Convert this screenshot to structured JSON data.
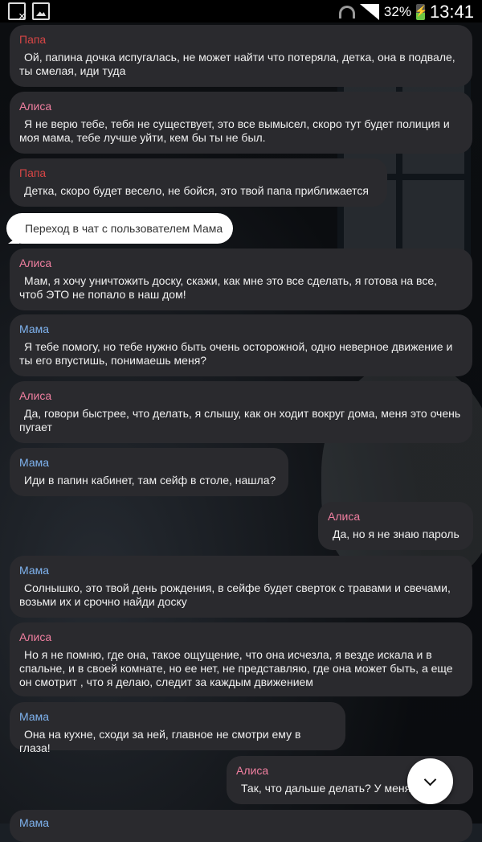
{
  "status": {
    "battery": "32%",
    "time": "13:41"
  },
  "messages": [
    {
      "sender": "Папа",
      "text": "Ой, папина дочка испугалась, не может найти что потеряла, детка, она в подвале, ты смелая, иди туда"
    },
    {
      "sender": "Алиса",
      "text": "Я не верю тебе, тебя не существует, это все вымысел, скоро тут будет полиция и моя мама, тебе лучше уйти, кем бы ты не был."
    },
    {
      "sender": "Папа",
      "text": "Детка, скоро будет весело, не бойся, это твой папа приближается"
    },
    {
      "system": "Переход в чат с пользователем Мама"
    },
    {
      "sender": "Алиса",
      "text": "Мам, я хочу уничтожить доску, скажи, как мне это все сделать, я готова на все, чтоб ЭТО не попало в наш дом!"
    },
    {
      "sender": "Мама",
      "text": "Я тебе помогу, но тебе нужно быть очень осторожной, одно неверное движение и ты его впустишь, понимаешь меня?"
    },
    {
      "sender": "Алиса",
      "text": "Да, говори быстрее, что делать, я слышу, как он ходит вокруг дома, меня это очень пугает"
    },
    {
      "sender": "Мама",
      "text": "Иди в папин кабинет, там сейф в столе, нашла?"
    },
    {
      "sender": "Алиса",
      "text": "Да, но я не знаю пароль"
    },
    {
      "sender": "Мама",
      "text": "Солнышко, это твой день рождения, в сейфе будет сверток с травами и свечами, возьми их и срочно найди доску"
    },
    {
      "sender": "Алиса",
      "text": "Но я не помню, где она, такое ощущение, что она исчезла, я везде искала и в спальне, и в своей комнате, но ее нет, не представляю, где она может быть, а еще он смотрит , что я делаю, следит за каждым движением"
    },
    {
      "sender": "Мама",
      "text": "Она на кухне, сходи за ней, главное не смотри ему в глаза!"
    },
    {
      "sender": "Алиса",
      "text": "Так, что дальше делать? У меня есть!"
    },
    {
      "sender": "Мама"
    }
  ]
}
